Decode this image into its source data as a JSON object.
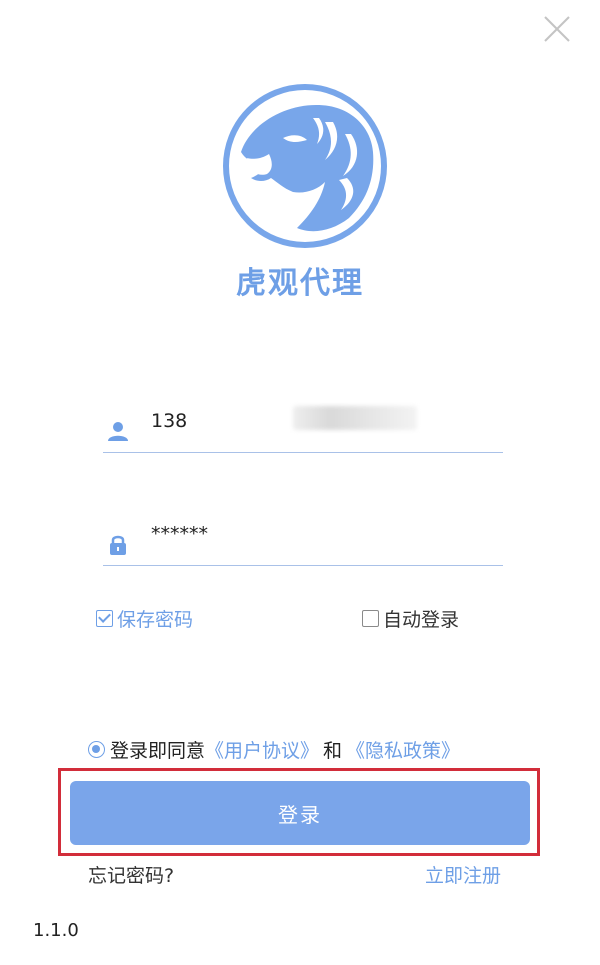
{
  "app": {
    "title": "虎观代理",
    "version": "1.1.0"
  },
  "login": {
    "username_value": "138",
    "password_value": "******",
    "save_password_label": "保存密码",
    "save_password_checked": true,
    "auto_login_label": "自动登录",
    "auto_login_checked": false,
    "agree_prefix": "登录即同意",
    "agree_checked": true,
    "user_agreement_link": "《用户协议》",
    "and_text": "和",
    "privacy_policy_link": "《隐私政策》",
    "submit_label": "登录",
    "forgot_password": "忘记密码?",
    "register": "立即注册"
  },
  "icons": {
    "close": "close-icon",
    "logo": "tiger-logo-icon",
    "user": "user-icon",
    "lock": "lock-icon"
  },
  "colors": {
    "accent": "#6e9fe6",
    "button": "#7aa5ea",
    "highlight": "#d22d3a"
  }
}
